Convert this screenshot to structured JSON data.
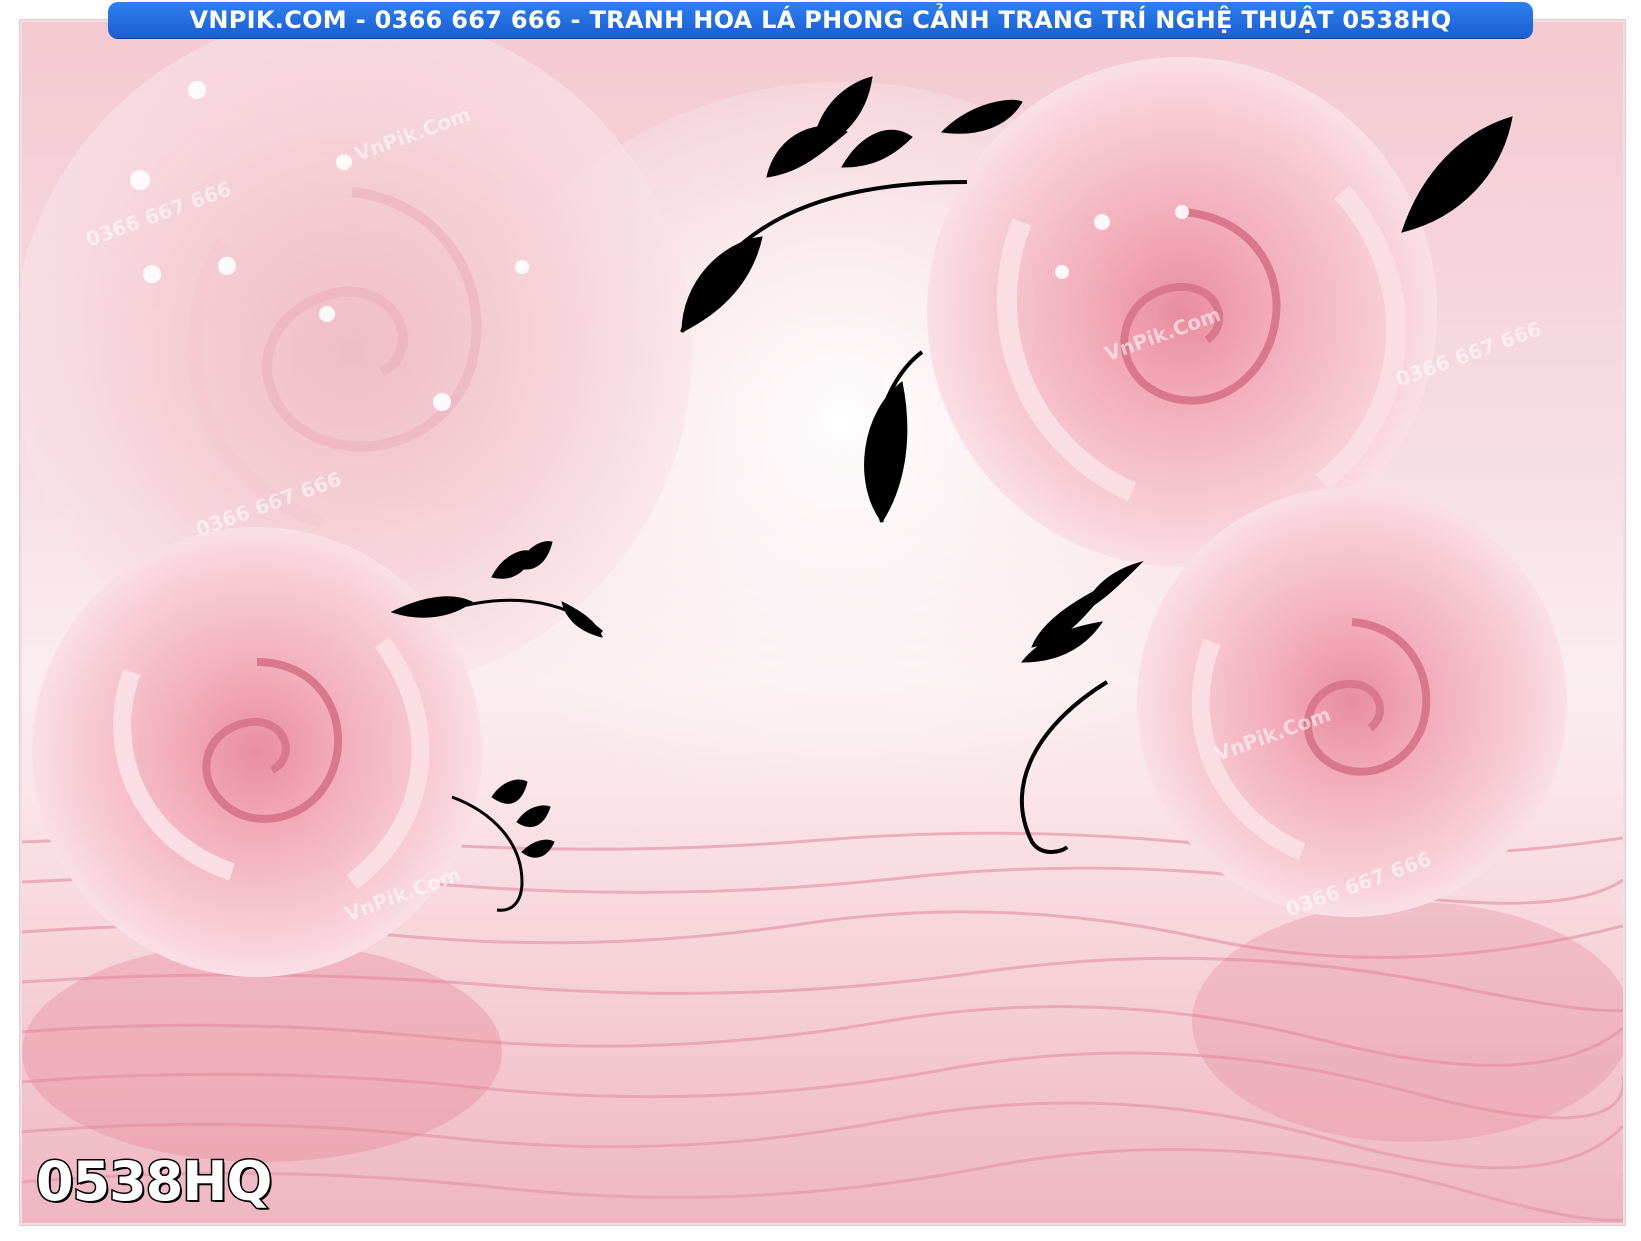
{
  "banner": {
    "text": "VNPIK.COM - 0366 667 666 - TRANH HOA LÁ PHONG CẢNH TRANG TRÍ NGHỆ THUẬT 0538HQ",
    "color": "#1f6ae0"
  },
  "product_code": "0538HQ",
  "watermarks": [
    "0366 667 666",
    "VnPik.Com",
    "0366 667 666",
    "VnPik.Com",
    "0366 667 666",
    "VnPik.Com",
    "0366 667 666",
    "VnPik.Com"
  ],
  "image": {
    "subject": "pink roses with black leaf vines reflected in rippling water",
    "colors": {
      "petal": "#f4a9b8",
      "petal_light": "#fbe0e6",
      "vine": "#000000",
      "water": "#f0c2cb"
    }
  }
}
